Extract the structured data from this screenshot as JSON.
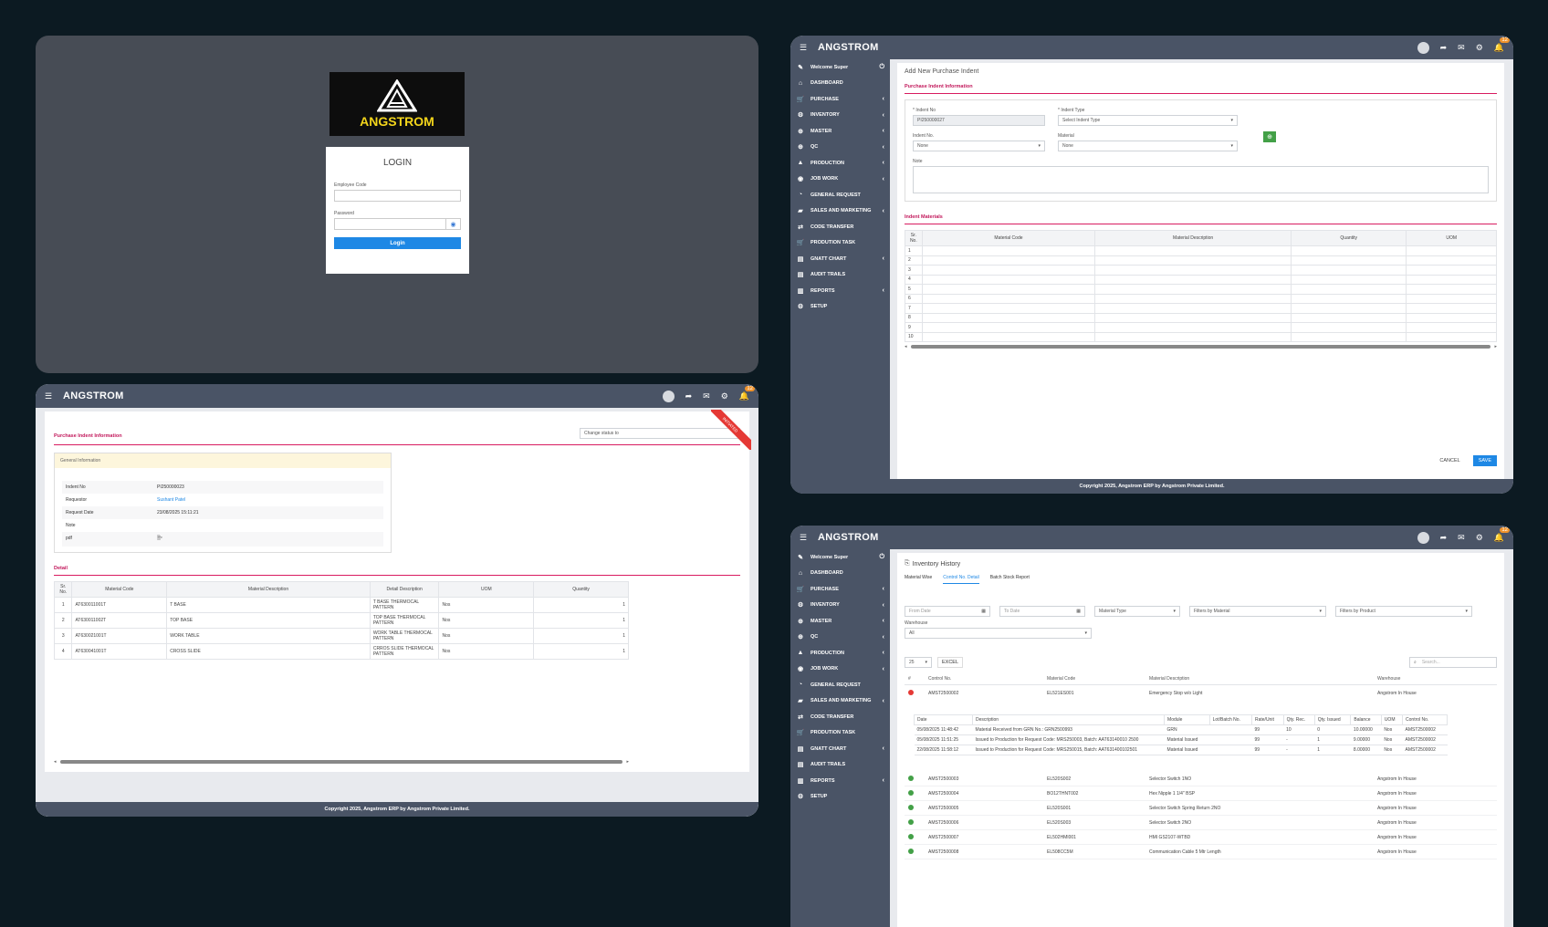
{
  "login": {
    "logo_text": "ANGSTROM",
    "title": "LOGIN",
    "employee_label": "Employee Code",
    "password_label": "Password",
    "button": "Login"
  },
  "app": {
    "brand": "ANGSTROM",
    "badge": "12",
    "footer": "Copyright 2025, Angstrom ERP by Angstrom Private Limited.",
    "welcome": "Welcome Super",
    "menu": [
      {
        "icon": "⌂",
        "label": "DASHBOARD",
        "arrow": ""
      },
      {
        "icon": "🛒",
        "label": "PURCHASE",
        "arrow": "‹"
      },
      {
        "icon": "⚙",
        "label": "INVENTORY",
        "arrow": "‹"
      },
      {
        "icon": "⊕",
        "label": "MASTER",
        "arrow": "‹"
      },
      {
        "icon": "⊕",
        "label": "QC",
        "arrow": "‹"
      },
      {
        "icon": "▲",
        "label": "PRODUCTION",
        "arrow": "‹"
      },
      {
        "icon": "◉",
        "label": "JOB WORK",
        "arrow": "‹"
      },
      {
        "icon": "◔",
        "label": "GENERAL REQUEST",
        "arrow": ""
      },
      {
        "icon": "▰",
        "label": "SALES AND MARKETING",
        "arrow": "‹"
      },
      {
        "icon": "⇄",
        "label": "CODE TRANSFER",
        "arrow": ""
      },
      {
        "icon": "🛒",
        "label": "PRODUTION TASK",
        "arrow": ""
      },
      {
        "icon": "▤",
        "label": "GNATT CHART",
        "arrow": "‹"
      },
      {
        "icon": "▤",
        "label": "AUDIT TRAILS",
        "arrow": ""
      },
      {
        "icon": "▥",
        "label": "REPORTS",
        "arrow": "‹"
      },
      {
        "icon": "⚙",
        "label": "SETUP",
        "arrow": ""
      }
    ]
  },
  "indent_view": {
    "section": "Purchase Indent Information",
    "status_placeholder": "Change status to",
    "ribbon": "INITIATED",
    "general_info": "General Information",
    "fields": [
      {
        "label": "Indent No",
        "value": "PI250000023"
      },
      {
        "label": "Requestor",
        "value": "Sushant Patel"
      },
      {
        "label": "Request Date",
        "value": "23/08/2025 15:11:21"
      },
      {
        "label": "Note",
        "value": ""
      },
      {
        "label": "pdf",
        "value": "🗎▾"
      }
    ],
    "detail": "Detail",
    "columns": [
      "Sr. No.",
      "Material Code",
      "Material Description",
      "Detail Description",
      "UOM",
      "Quantity"
    ],
    "rows": [
      [
        "1",
        "AT630011001T",
        "T BASE",
        "T BASE THERMOCAL PATTERN",
        "Nos",
        "1"
      ],
      [
        "2",
        "AT630011002T",
        "TOP BASE",
        "TOP BASE THERMOCAL PATTERN",
        "Nos",
        "1"
      ],
      [
        "3",
        "AT630021001T",
        "WORK TABLE",
        "WORK TABLE THERMOCAL PATTERN",
        "Nos",
        "1"
      ],
      [
        "4",
        "AT630041001T",
        "CROSS SLIDE",
        "CRROS SLIDE THERMOCAL PATTERN",
        "Nos",
        "1"
      ]
    ]
  },
  "new_indent": {
    "title": "Add New Purchase Indent",
    "section": "Purchase Indent Information",
    "indent_no_label": "* Indent No",
    "indent_no_value": "PI250000027",
    "indent_type_label": "* Indent Type",
    "indent_type_value": "Select Indent Type",
    "indent_no2_label": "Indent No.",
    "indent_no2_value": "None",
    "material_label": "Material",
    "material_value": "None",
    "note_label": "Note",
    "materials_section": "Indent Materials",
    "columns": [
      "Sr. No.",
      "Material Code",
      "Material Description",
      "Quantity",
      "UOM"
    ],
    "row_numbers": [
      "1",
      "2",
      "3",
      "4",
      "5",
      "6",
      "7",
      "8",
      "9",
      "10"
    ],
    "cancel": "CANCEL",
    "save": "SAVE"
  },
  "inventory": {
    "title": "Inventory History",
    "tabs": [
      "Material Wise",
      "Control No. Detail",
      "Batch Stock Report"
    ],
    "from_date": "From Date",
    "to_date": "To Date",
    "material_type": "Material Type",
    "filter_material": "Filters by Material",
    "filter_product": "Filters by Product",
    "warehouse_label": "Warehouse",
    "warehouse_value": "All",
    "page_size": "25",
    "excel": "EXCEL",
    "search_placeholder": "Search...",
    "columns": [
      "#",
      "Control No.",
      "Material Code",
      "Material Description",
      "Warehouse"
    ],
    "expanded": {
      "control": "AMST2500002",
      "code": "EL521ES001",
      "desc": "Emergency Stop w/o Light",
      "warehouse": "Angstrom In House"
    },
    "sub_columns": [
      "Date",
      "Description",
      "Module",
      "Lot/Batch No.",
      "Rate/Unit",
      "Qty. Rec.",
      "Qty. Issued",
      "Balance",
      "UOM",
      "Control No."
    ],
    "sub_rows": [
      [
        "05/08/2025 11:48:42",
        "Material Received from GRN No.: GRN2500993",
        "GRN",
        "",
        "99",
        "10",
        "0",
        "10.00000",
        "Nos",
        "AMST2500002"
      ],
      [
        "05/08/2025 11:51:25",
        "Issued to Production for Request Code: MRS250003, Batch: AAT63140010 2500",
        "Material Issued",
        "",
        "99",
        "-",
        "1",
        "9.00000",
        "Nos",
        "AMST2500002"
      ],
      [
        "22/08/2025 11:58:12",
        "Issued to Production for Request Code: MRS250015, Batch: AAT631400102501",
        "Material Issued",
        "",
        "99",
        "-",
        "1",
        "8.00000",
        "Nos",
        "AMST2500002"
      ]
    ],
    "rows": [
      [
        "AMST2500003",
        "EL520S002",
        "Selector Switch 1NO",
        "Angstrom In House"
      ],
      [
        "AMST2500004",
        "BO12THNT002",
        "Hex Nipple 1 1/4\" BSP",
        "Angstrom In House"
      ],
      [
        "AMST2500005",
        "EL520S001",
        "Selector Switch Spring Return 2NO",
        "Angstrom In House"
      ],
      [
        "AMST2500006",
        "EL520S003",
        "Selector Switch 2NO",
        "Angstrom In House"
      ],
      [
        "AMST2500007",
        "EL502HMI001",
        "HMI GS2107-WTBD",
        "Angstrom In House"
      ],
      [
        "AMST2500008",
        "EL508CC5M",
        "Communication Cable 5 Mtr Length",
        "Angstrom In House"
      ]
    ]
  }
}
